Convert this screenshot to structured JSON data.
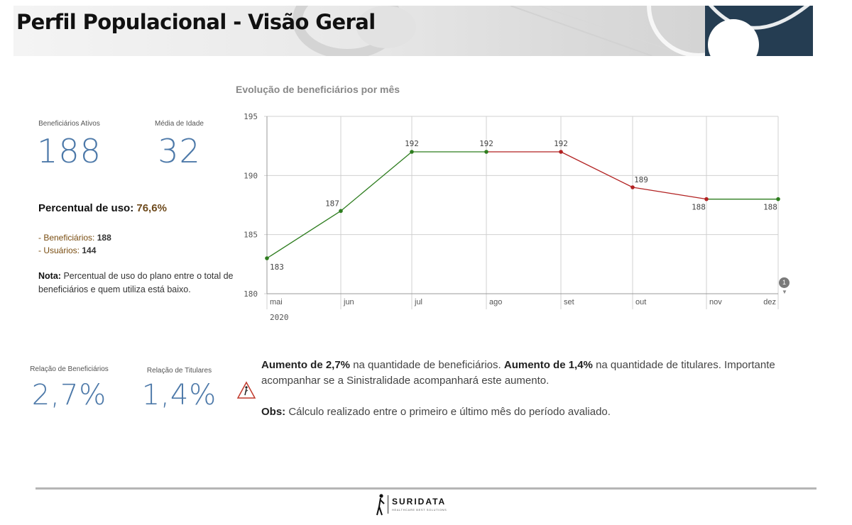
{
  "header": {
    "title": "Perfil Populacional - Visão Geral"
  },
  "kpis": {
    "ativos_label": "Beneficiários Ativos",
    "ativos_value": "188",
    "idade_label": "Média de Idade",
    "idade_value": "32",
    "rel_benef_label": "Relação de Beneficiários",
    "rel_benef_value": "2,7%",
    "rel_tit_label": "Relação de Titulares",
    "rel_tit_value": "1,4%"
  },
  "uso": {
    "title": "Percentual de uso:",
    "value": "76,6%",
    "benef_label": "- Beneficiários:",
    "benef_value": "188",
    "usuarios_label": "- Usuários:",
    "usuarios_value": "144",
    "nota_label": "Nota:",
    "nota_text": "Percentual de uso do plano entre o total de beneficiários e quem utiliza está baixo."
  },
  "info": {
    "aumento1_bold": "Aumento de 2,7%",
    "aumento1_text": "na quantidade de beneficiários.",
    "aumento2_bold": "Aumento de 1,4%",
    "aumento2_text": "na quantidade de titulares. Importante acompanhar se a Sinistralidade acompanhará este aumento.",
    "obs_bold": "Obs:",
    "obs_text": "Cálculo realizado entre o primeiro e último mês do período avaliado."
  },
  "chart_badge": "1",
  "footer": {
    "brand": "SURIDATA",
    "tagline": "HEALTHCARE BEST SOLUTIONS"
  },
  "colors": {
    "increase": "#2e7d1f",
    "decrease": "#b22222",
    "kpi": "#4d79a9",
    "navy": "#253d52"
  },
  "chart_data": {
    "type": "line",
    "title": "Evolução de beneficiários por mês",
    "categories": [
      "mai",
      "jun",
      "jul",
      "ago",
      "set",
      "out",
      "nov",
      "dez"
    ],
    "year_label": "2020",
    "values": [
      183,
      187,
      192,
      192,
      192,
      189,
      188,
      188
    ],
    "data_labels": [
      "183",
      "187",
      "192",
      "192",
      "192",
      "189",
      "188",
      "188"
    ],
    "ylim": [
      180,
      195
    ],
    "yticks": [
      180,
      185,
      190,
      195
    ],
    "grid": true,
    "segment_colors": [
      "increase",
      "increase",
      "increase",
      "decrease",
      "decrease",
      "decrease",
      "increase"
    ]
  }
}
